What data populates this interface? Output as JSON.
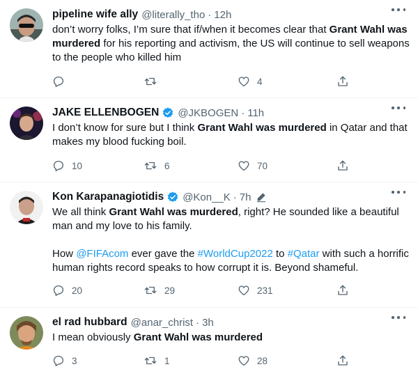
{
  "colors": {
    "text": "#0f1419",
    "secondary": "#536471",
    "link": "#1d9bf0",
    "verified": "#1d9bf0",
    "divider": "#eff3f4"
  },
  "tweets": [
    {
      "display_name": "pipeline wife ally",
      "handle": "@literally_tho",
      "dot": "·",
      "time": "12h",
      "verified": false,
      "edited": false,
      "text": [
        {
          "t": "don’t worry folks, I’m sure that if/when it becomes clear that "
        },
        {
          "t": "Grant Wahl was murdered",
          "b": true
        },
        {
          "t": " for his reporting and activism, the US will continue to sell weapons to the people who killed him"
        }
      ],
      "replies": "",
      "retweets": "",
      "likes": "4",
      "icons": [
        "reply-icon",
        "retweet-icon",
        "like-icon",
        "share-icon"
      ]
    },
    {
      "display_name": "JAKE ELLENBOGEN",
      "handle": "@JKBOGEN",
      "dot": "·",
      "time": "11h",
      "verified": true,
      "edited": false,
      "text": [
        {
          "t": "I don’t know for sure but I think "
        },
        {
          "t": "Grant Wahl was murdered",
          "b": true
        },
        {
          "t": " in Qatar and that makes my blood fucking boil."
        }
      ],
      "replies": "10",
      "retweets": "6",
      "likes": "70"
    },
    {
      "display_name": "Kon Karapanagiotidis",
      "handle": "@Kon__K",
      "dot": "·",
      "time": "7h",
      "verified": true,
      "edited": true,
      "text": [
        {
          "t": "We all think "
        },
        {
          "t": "Grant Wahl was murdered",
          "b": true
        },
        {
          "t": ", right? He sounded like a beautiful man and my love to his family."
        },
        {
          "br": true
        },
        {
          "t": "How "
        },
        {
          "t": "@FIFAcom",
          "link": true
        },
        {
          "t": " ever gave the "
        },
        {
          "t": "#WorldCup2022",
          "link": true
        },
        {
          "t": " to "
        },
        {
          "t": "#Qatar",
          "link": true
        },
        {
          "t": " with such a horrific human rights record speaks to how corrupt it is. Beyond shameful."
        }
      ],
      "replies": "20",
      "retweets": "29",
      "likes": "231"
    },
    {
      "display_name": "el rad hubbard",
      "handle": "@anar_christ",
      "dot": "·",
      "time": "3h",
      "verified": false,
      "edited": false,
      "text": [
        {
          "t": "I mean obviously "
        },
        {
          "t": "Grant Wahl was murdered",
          "b": true
        }
      ],
      "replies": "3",
      "retweets": "1",
      "likes": "28"
    }
  ]
}
